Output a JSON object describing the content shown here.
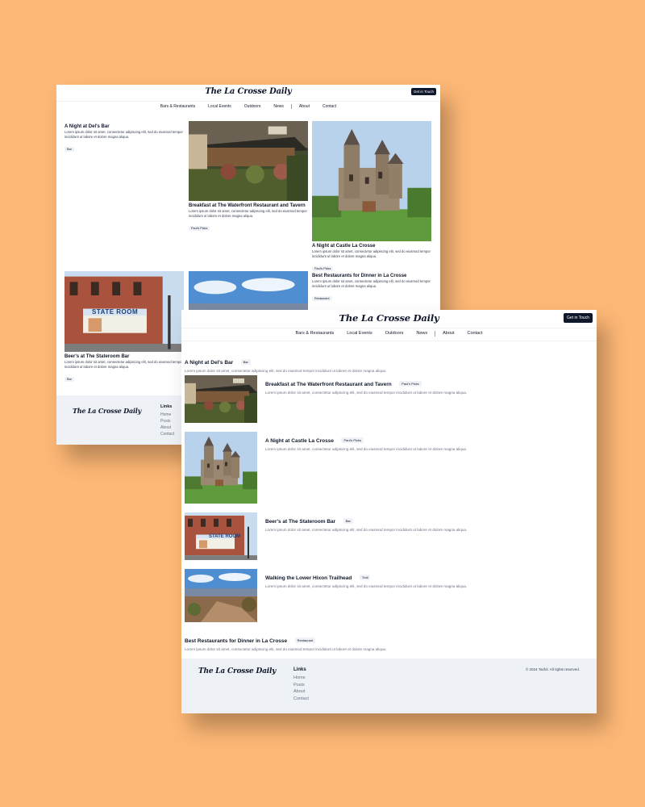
{
  "brand": "The La Crosse Daily",
  "header": {
    "cta_label": "Get in Touch"
  },
  "nav": [
    "Bars & Restaurants",
    "Local Events",
    "Outdoors",
    "News",
    "About",
    "Contact"
  ],
  "posts": [
    {
      "title": "A Night at Del's Bar",
      "tag": "Bar",
      "excerpt": "Lorem ipsum dolor sit amet, consectetur adipiscing elit, sed do eiusmod tempor incididunt ut labore et dolore magna aliqua."
    },
    {
      "title": "Breakfast at The Waterfront Restaurant and Tavern",
      "tag": "Paul's Picks",
      "excerpt": "Lorem ipsum dolor sit amet, consectetur adipiscing elit, sed do eiusmod tempor incididunt ut labore et dolore magna aliqua."
    },
    {
      "title": "A Night at Castle La Crosse",
      "tag": "Paul's Picks",
      "excerpt": "Lorem ipsum dolor sit amet, consectetur adipiscing elit, sed do eiusmod tempor incididunt ut labore et dolore magna aliqua."
    },
    {
      "title": "Beer's at The Stateroom Bar",
      "tag": "Bar",
      "excerpt": "Lorem ipsum dolor sit amet, consectetur adipiscing elit, sed do eiusmod tempor incididunt ut labore et dolore magna aliqua."
    },
    {
      "title": "Walking the Lower Hixon Trailhead",
      "tag": "Trail",
      "excerpt": "Lorem ipsum dolor sit amet, consectetur adipiscing elit, sed do eiusmod tempor incididunt ut labore et dolore magna aliqua."
    },
    {
      "title": "Best Restaurants for Dinner in La Crosse",
      "tag": "Restaurant",
      "excerpt": "Lorem ipsum dolor sit amet, consectetur adipiscing elit, sed do eiusmod tempor incididunt ut labore et dolore magna aliqua."
    }
  ],
  "stateroom_sign": "STATE ROOM",
  "footer": {
    "links_heading": "Links",
    "links": [
      "Home",
      "Posts",
      "About",
      "Contact"
    ],
    "copyright": "© 2024 Taxfol. All rights reserved."
  },
  "colors": {
    "background": "#FDB877",
    "dark": "#0f172a",
    "footer_bg": "#eef2f7",
    "tag_bg": "#eef1f5"
  }
}
